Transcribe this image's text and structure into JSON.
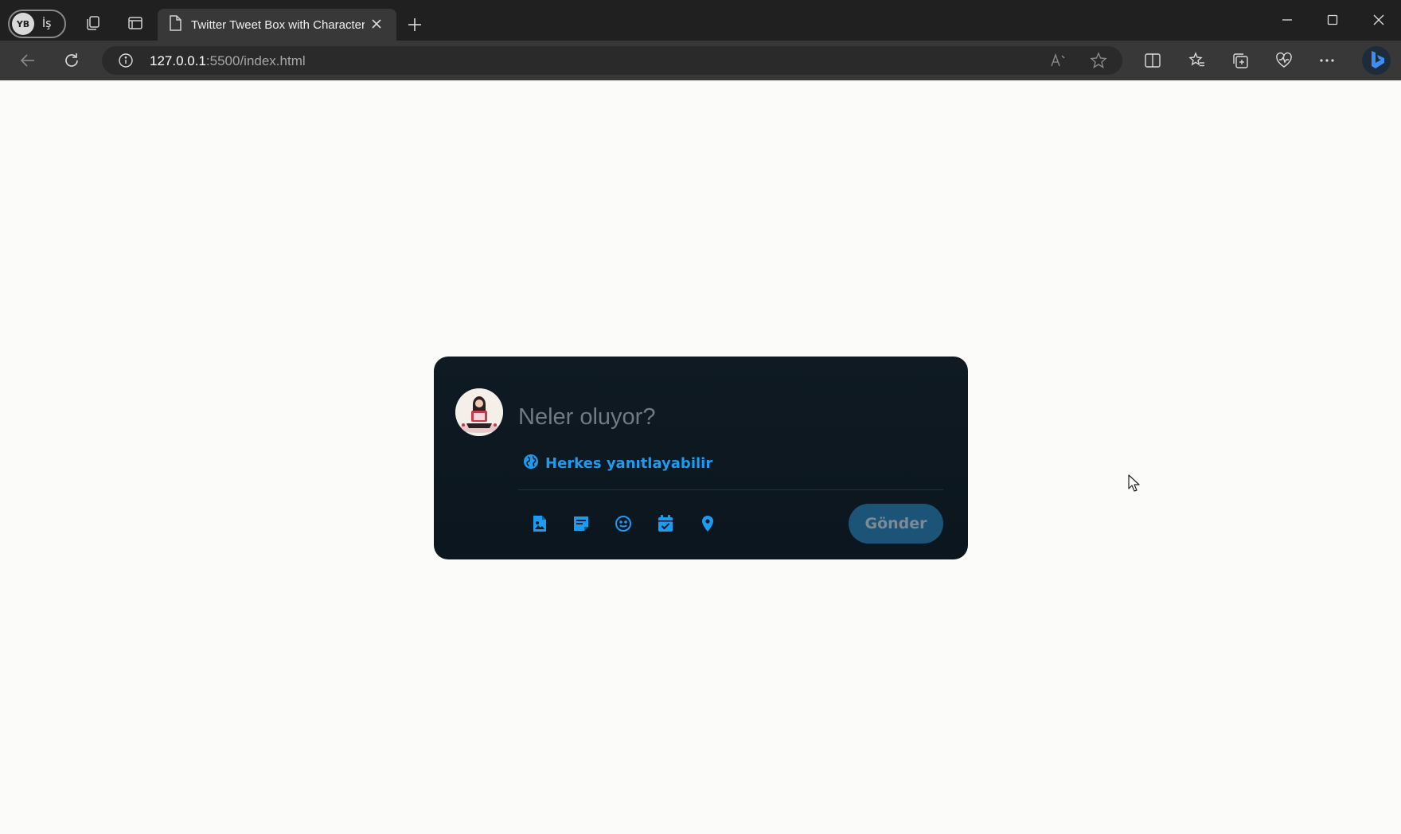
{
  "browser": {
    "profile_initials": "YB",
    "profile_label": "İş",
    "tab_title": "Twitter Tweet Box with Character",
    "url_host": "127.0.0.1",
    "url_path": ":5500/index.html"
  },
  "tweet_box": {
    "placeholder": "Neler oluyor?",
    "reply_setting": "Herkes yanıtlayabilir",
    "send_label": "Gönder",
    "tools": [
      "image-icon",
      "gif-icon",
      "emoji-icon",
      "schedule-icon",
      "location-icon"
    ]
  },
  "colors": {
    "accent": "#1d9bf0",
    "card_bg": "#0f1a22",
    "send_disabled": "#1b5477",
    "page_bg": "#fbfbf9"
  }
}
